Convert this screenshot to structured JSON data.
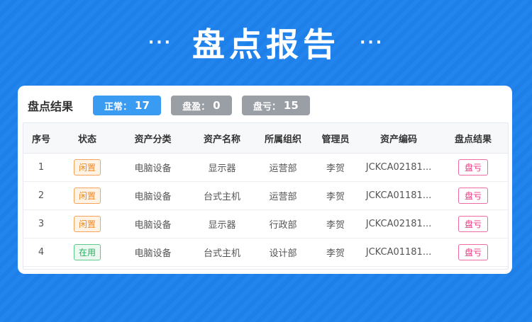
{
  "header": {
    "title": "盘点报告",
    "left_dots": "···",
    "right_dots": "···"
  },
  "summary": {
    "title": "盘点结果",
    "pills": [
      {
        "label": "正常：",
        "count": "17",
        "color": "#3a9bf2"
      },
      {
        "label": "盘盈：",
        "count": "0",
        "color": "#9a9ea5"
      },
      {
        "label": "盘亏：",
        "count": "15",
        "color": "#9a9ea5"
      }
    ]
  },
  "table": {
    "columns": [
      "序号",
      "状态",
      "资产分类",
      "资产名称",
      "所属组织",
      "管理员",
      "资产编码",
      "盘点结果"
    ],
    "rows": [
      {
        "index": "1",
        "status": "闲置",
        "category": "电脑设备",
        "name": "显示器",
        "org": "运营部",
        "admin": "李贺",
        "code": "JCKCA02181...",
        "result": "盘亏"
      },
      {
        "index": "2",
        "status": "闲置",
        "category": "电脑设备",
        "name": "台式主机",
        "org": "运营部",
        "admin": "李贺",
        "code": "JCKCA01181...",
        "result": "盘亏"
      },
      {
        "index": "3",
        "status": "闲置",
        "category": "电脑设备",
        "name": "显示器",
        "org": "行政部",
        "admin": "李贺",
        "code": "JCKCA02181...",
        "result": "盘亏"
      },
      {
        "index": "4",
        "status": "在用",
        "category": "电脑设备",
        "name": "台式主机",
        "org": "设计部",
        "admin": "李贺",
        "code": "JCKCA01181...",
        "result": "盘亏"
      }
    ]
  },
  "colors": {
    "background": "#1f7fe9",
    "idle": "#f08a24",
    "in_use": "#27ae60",
    "loss": "#e8357f"
  }
}
